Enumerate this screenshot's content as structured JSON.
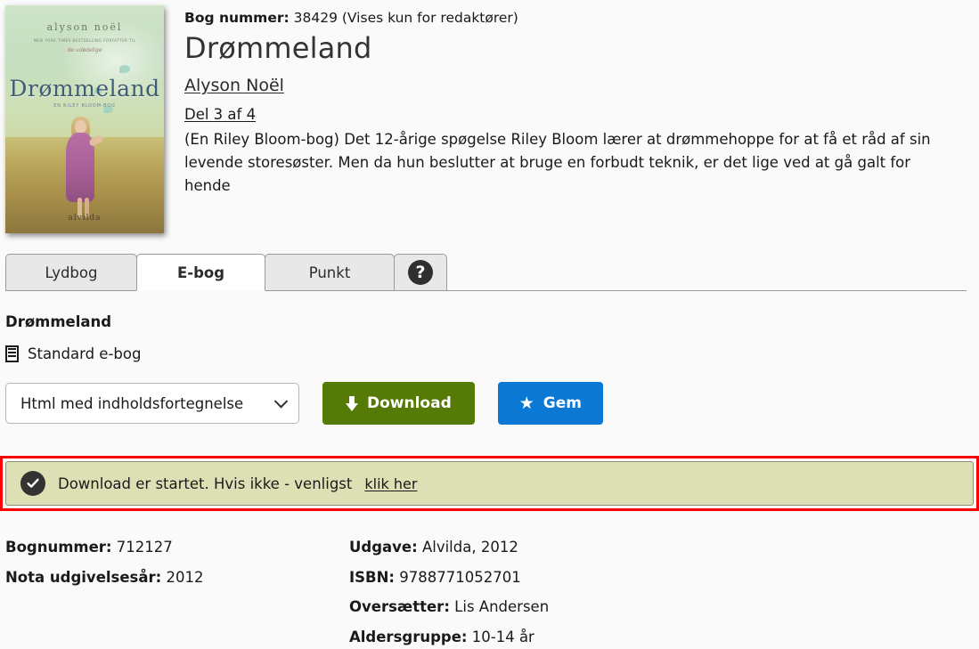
{
  "book": {
    "book_number_label": "Bog nummer:",
    "book_number_value": "38429",
    "book_number_note": "(Vises kun for redaktører)",
    "title": "Drømmeland",
    "author": "Alyson Noël",
    "part": "Del 3 af 4",
    "description": "(En Riley Bloom-bog) Det 12-årige spøgelse Riley Bloom lærer at drømmehoppe for at få et råd af sin levende storesøster. Men da hun beslutter at bruge en forbudt teknik, er det lige ved at gå galt for hende"
  },
  "cover": {
    "author": "alyson noël",
    "blurb": "NEW YORK TIMES BESTSELLING FORFATTER TIL",
    "blurb2": "de udødelige",
    "title": "Drømmeland",
    "subtitle": "EN RILEY BLOOM-BOG",
    "publisher": "alvilda"
  },
  "tabs": [
    {
      "label": "Lydbog",
      "active": false
    },
    {
      "label": "E-bog",
      "active": true
    },
    {
      "label": "Punkt",
      "active": false
    }
  ],
  "help_tab": {
    "icon": "question-mark-icon",
    "label": "?"
  },
  "panel": {
    "format_title": "Drømmeland",
    "format_icon": "document-icon",
    "format_name": "Standard e-bog",
    "select": {
      "value": "Html med indholdsfortegnelse",
      "options": [
        "Html med indholdsfortegnelse"
      ]
    },
    "download_button": {
      "label": "Download",
      "icon": "download-arrow-icon",
      "color": "#557a06"
    },
    "save_button": {
      "label": "Gem",
      "icon": "star-icon",
      "color": "#0b78d4"
    }
  },
  "alert": {
    "icon": "check-circle-icon",
    "text": "Download er startet. Hvis ikke - venligst",
    "link": "klik her",
    "border_color": "#fe0000",
    "background_color": "#dde0b4"
  },
  "metadata": {
    "left": [
      {
        "label": "Bognummer:",
        "value": "712127"
      },
      {
        "label": "Nota udgivelsesår:",
        "value": "2012"
      }
    ],
    "right": [
      {
        "label": "Udgave:",
        "value": "Alvilda, 2012"
      },
      {
        "label": "ISBN:",
        "value": "9788771052701"
      },
      {
        "label": "Oversætter:",
        "value": "Lis Andersen"
      },
      {
        "label": "Aldersgruppe:",
        "value": "10-14 år"
      }
    ]
  }
}
